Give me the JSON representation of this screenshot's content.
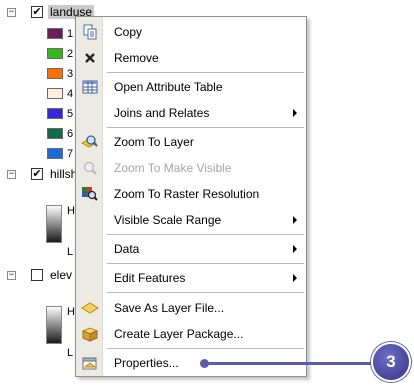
{
  "toc": {
    "layers": [
      {
        "name": "landuse",
        "checked": true,
        "expander": "⊟"
      },
      {
        "name": "hillsh",
        "checked": true,
        "expander": "⊟"
      },
      {
        "name": "elev",
        "checked": false,
        "expander": "⊟"
      }
    ],
    "landuse_classes": [
      {
        "label": "1",
        "color": "#6b1d5c"
      },
      {
        "label": "2",
        "color": "#33b81b"
      },
      {
        "label": "3",
        "color": "#ff6f00"
      },
      {
        "label": "4",
        "color": "#fbefe2"
      },
      {
        "label": "5",
        "color": "#3429d9"
      },
      {
        "label": "6",
        "color": "#136a4a"
      },
      {
        "label": "7",
        "color": "#1b6bd6"
      }
    ],
    "hillshade_legend": {
      "high": "H",
      "low": "L"
    },
    "elev_legend": {
      "high": "H",
      "low": "L"
    }
  },
  "menu": {
    "items": [
      {
        "label": "Copy",
        "icon": "copy-icon",
        "disabled": false,
        "submenu": false
      },
      {
        "label": "Remove",
        "icon": "remove-icon",
        "disabled": false,
        "submenu": false
      },
      {
        "label": "Open Attribute Table",
        "icon": "table-icon",
        "disabled": false,
        "submenu": false
      },
      {
        "label": "Joins and Relates",
        "icon": "",
        "disabled": false,
        "submenu": true
      },
      {
        "label": "Zoom To Layer",
        "icon": "zoom-to-layer-icon",
        "disabled": false,
        "submenu": false
      },
      {
        "label": "Zoom To Make Visible",
        "icon": "zoom-visible-icon",
        "disabled": true,
        "submenu": false
      },
      {
        "label": "Zoom To Raster Resolution",
        "icon": "zoom-raster-icon",
        "disabled": false,
        "submenu": false
      },
      {
        "label": "Visible Scale Range",
        "icon": "",
        "disabled": false,
        "submenu": true
      },
      {
        "label": "Data",
        "icon": "",
        "disabled": false,
        "submenu": true
      },
      {
        "label": "Edit Features",
        "icon": "",
        "disabled": false,
        "submenu": true
      },
      {
        "label": "Save As Layer File...",
        "icon": "save-layer-icon",
        "disabled": false,
        "submenu": false
      },
      {
        "label": "Create Layer Package...",
        "icon": "layer-package-icon",
        "disabled": false,
        "submenu": false
      },
      {
        "label": "Properties...",
        "icon": "properties-icon",
        "disabled": false,
        "submenu": false
      }
    ]
  },
  "callout": {
    "number": "3",
    "color": "#5c5cae"
  }
}
